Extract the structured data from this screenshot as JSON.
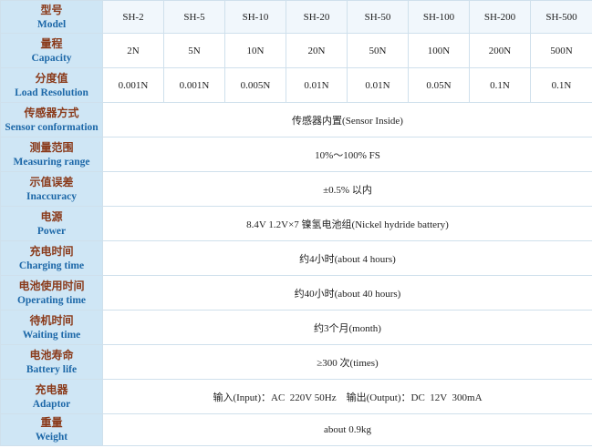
{
  "rows": {
    "model": {
      "cn": "型号",
      "en": "Model",
      "values": [
        "SH-2",
        "SH-5",
        "SH-10",
        "SH-20",
        "SH-50",
        "SH-100",
        "SH-200",
        "SH-500"
      ]
    },
    "capacity": {
      "cn": "量程",
      "en": "Capacity",
      "values": [
        "2N",
        "5N",
        "10N",
        "20N",
        "50N",
        "100N",
        "200N",
        "500N"
      ]
    },
    "resolution": {
      "cn": "分度值",
      "en": "Load Resolution",
      "values": [
        "0.001N",
        "0.001N",
        "0.005N",
        "0.01N",
        "0.01N",
        "0.05N",
        "0.1N",
        "0.1N"
      ]
    },
    "sensor": {
      "cn": "传感器方式",
      "en": "Sensor conformation",
      "value": "传感器内置(Sensor Inside)"
    },
    "range": {
      "cn": "测量范围",
      "en": "Measuring range",
      "value": "10%～100% FS"
    },
    "accuracy": {
      "cn": "示值误差",
      "en": "Inaccuracy",
      "value": "±0.5% 以内"
    },
    "power": {
      "cn": "电源",
      "en": "Power",
      "value": "8.4V  1.2V×7 镍氢电池组(Nickel hydride battery)"
    },
    "charging": {
      "cn": "充电时间",
      "en": "Charging time",
      "value": "约4小时(about 4 hours)"
    },
    "operating": {
      "cn": "电池使用时间",
      "en": "Operating time",
      "value": "约40小时(about 40 hours)"
    },
    "waiting": {
      "cn": "待机时间",
      "en": "Waiting time",
      "value": "约3个月(month)"
    },
    "battery": {
      "cn": "电池寿命",
      "en": "Battery life",
      "value": "≥300 次(times)"
    },
    "adaptor": {
      "cn": "充电器",
      "en": "Adaptor",
      "value": "输入(Input)：AC  220V 50Hz    输出(Output)：DC  12V  300mA"
    },
    "weight": {
      "cn": "重量",
      "en": "Weight",
      "value": "about 0.9kg"
    }
  }
}
